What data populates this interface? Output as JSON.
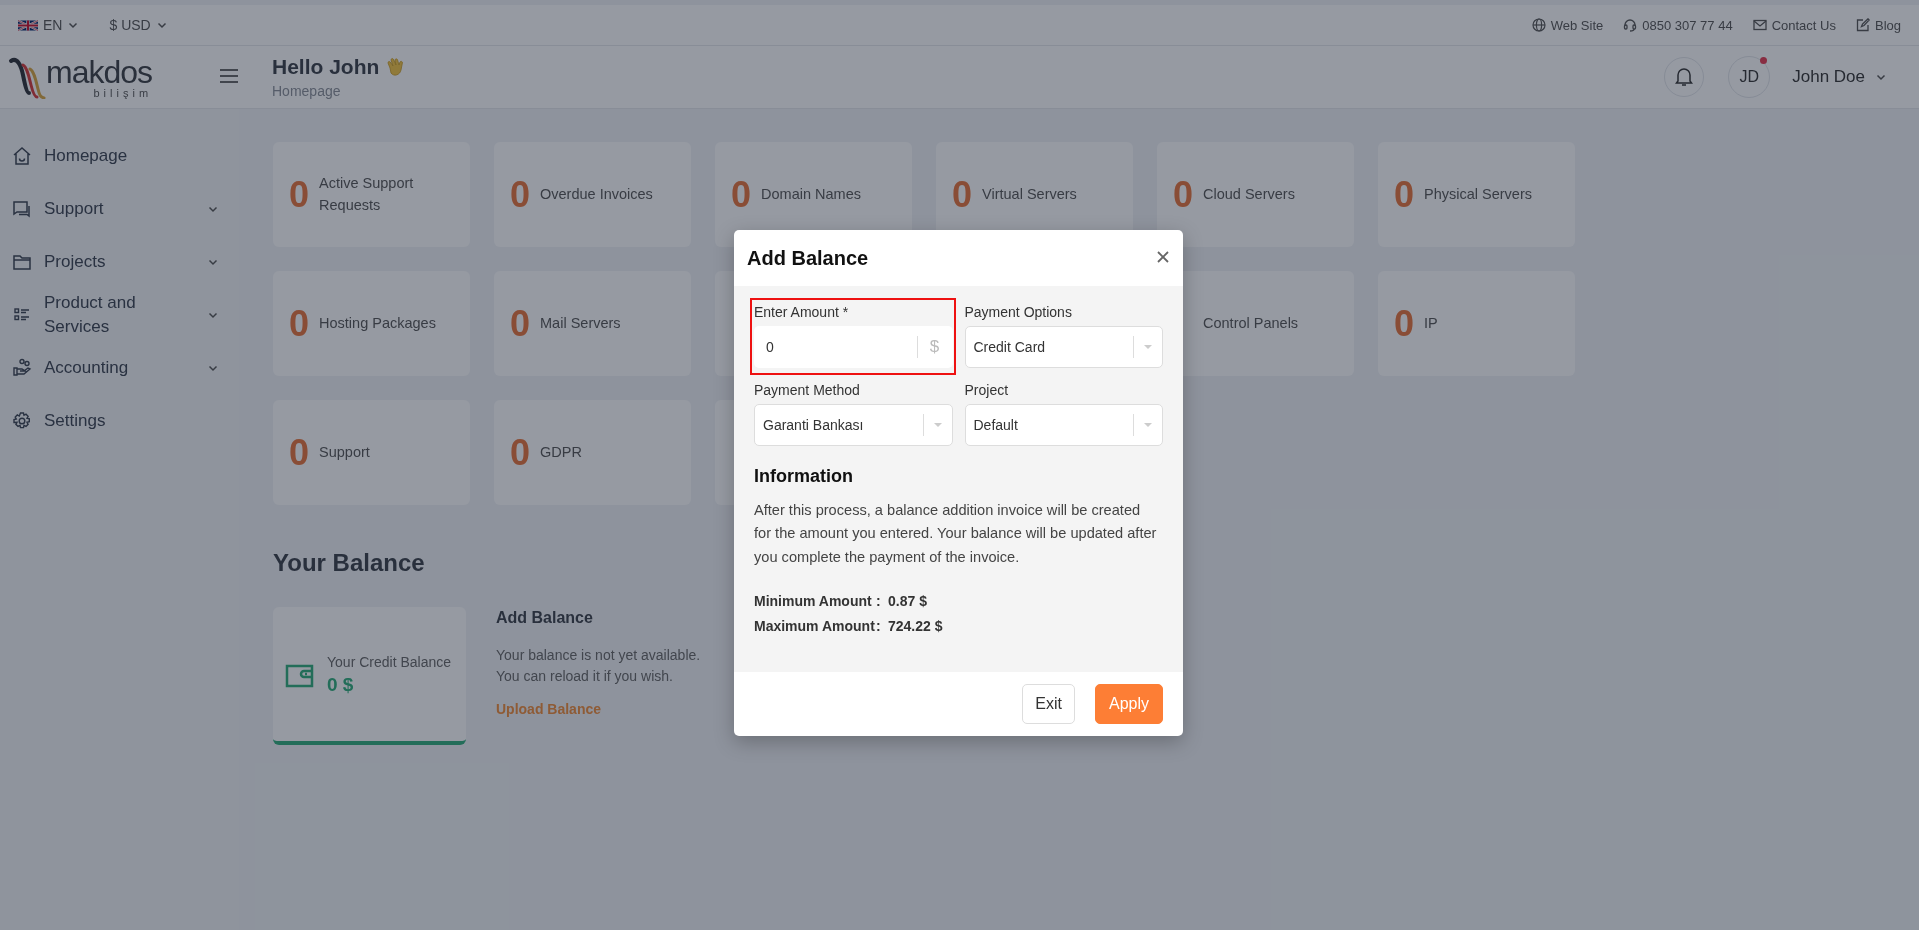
{
  "top_bar": {
    "language": "EN",
    "currency": "$ USD",
    "links": [
      {
        "kind": "globe",
        "label": "Web Site"
      },
      {
        "kind": "headset",
        "label": "0850 307 77 44"
      },
      {
        "kind": "mail",
        "label": "Contact Us"
      },
      {
        "kind": "edit",
        "label": "Blog"
      }
    ]
  },
  "header": {
    "logo": {
      "name": "makdos",
      "tagline": "bilişim"
    },
    "greeting": "Hello John",
    "breadcrumb": "Homepage",
    "avatar": "JD",
    "notification_dot": true,
    "user": "John Doe"
  },
  "sidebar": {
    "items": [
      {
        "kind": "home",
        "label": "Homepage",
        "expandable": false
      },
      {
        "kind": "chat",
        "label": "Support",
        "expandable": true
      },
      {
        "kind": "folder",
        "label": "Projects",
        "expandable": true
      },
      {
        "kind": "list",
        "label": "Product and Services",
        "expandable": true
      },
      {
        "kind": "hand",
        "label": "Accounting",
        "expandable": true
      },
      {
        "kind": "gear",
        "label": "Settings",
        "expandable": false
      }
    ]
  },
  "stats": [
    {
      "kind": "stat",
      "count": "0",
      "label": "Active Support Requests"
    },
    {
      "kind": "stat",
      "count": "0",
      "label": "Overdue Invoices"
    },
    {
      "kind": "stat",
      "count": "0",
      "label": "Domain Names"
    },
    {
      "kind": "stat",
      "count": "0",
      "label": "Virtual Servers"
    },
    {
      "kind": "stat",
      "count": "0",
      "label": "Cloud Servers"
    },
    {
      "kind": "stat",
      "count": "0",
      "label": "Physical Servers"
    },
    {
      "kind": "stat",
      "count": "0",
      "label": "Hosting Packages"
    },
    {
      "kind": "stat",
      "count": "0",
      "label": "Mail Servers"
    },
    {
      "kind": "hidden"
    },
    {
      "kind": "gap"
    },
    {
      "kind": "stat",
      "label": "Control Panels"
    },
    {
      "kind": "stat",
      "count": "0",
      "label": "IP"
    },
    {
      "kind": "stat",
      "count": "0",
      "label": "Support"
    },
    {
      "kind": "stat",
      "count": "0",
      "label": "GDPR"
    },
    {
      "kind": "hidden"
    }
  ],
  "balance": {
    "title": "Your Balance",
    "card": {
      "label": "Your Credit Balance",
      "amount": "0 $"
    },
    "add": {
      "title": "Add Balance",
      "lines": [
        "Your balance is not yet available.",
        "You can reload it if you wish."
      ],
      "link": "Upload Balance"
    }
  },
  "modal": {
    "title": "Add Balance",
    "fields": [
      {
        "kind": "input",
        "label": "Enter Amount *",
        "value": "0",
        "suffix": "$",
        "highlighted": true
      },
      {
        "kind": "select",
        "label": "Payment Options",
        "value": "Credit Card"
      },
      {
        "kind": "select",
        "label": "Payment Method",
        "value": "Garanti Bankası"
      },
      {
        "kind": "select",
        "label": "Project",
        "value": "Default"
      }
    ],
    "info_title": "Information",
    "info_text": "After this process, a balance addition invoice will be created for the amount you entered. Your balance will be updated after you complete the payment of the invoice.",
    "limits": [
      {
        "label": "Minimum Amount",
        "separator": ":",
        "value": "0.87 $"
      },
      {
        "label": "Maximum Amount",
        "separator": ":",
        "value": "724.22 $"
      }
    ],
    "buttons": [
      {
        "kind": "secondary",
        "label": "Exit"
      },
      {
        "kind": "primary",
        "label": "Apply"
      }
    ]
  }
}
